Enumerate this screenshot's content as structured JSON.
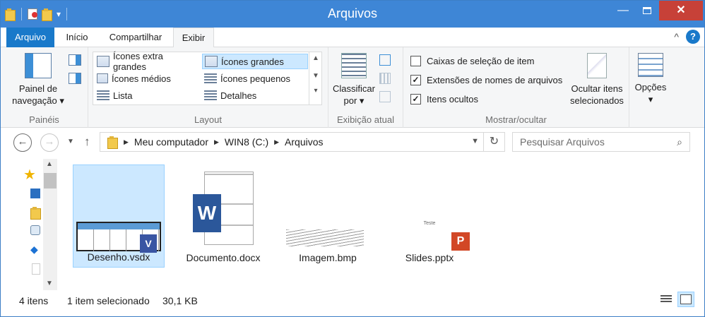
{
  "window": {
    "title": "Arquivos",
    "minimize_label": "—",
    "close_label": "✕"
  },
  "qat": {
    "dropdown_icon": "▾"
  },
  "tabs": [
    {
      "label": "Arquivo"
    },
    {
      "label": "Início"
    },
    {
      "label": "Compartilhar"
    },
    {
      "label": "Exibir"
    }
  ],
  "help_label": "?",
  "collapse_icon": "^",
  "ribbon": {
    "panes": {
      "group_label": "Painéis",
      "nav_pane_line1": "Painel de",
      "nav_pane_line2": "navegação ▾"
    },
    "layout": {
      "group_label": "Layout",
      "options": [
        {
          "label": "Ícones extra grandes"
        },
        {
          "label": "Ícones grandes",
          "selected": true
        },
        {
          "label": "Ícones médios"
        },
        {
          "label": "Ícones pequenos"
        },
        {
          "label": "Lista"
        },
        {
          "label": "Detalhes"
        }
      ]
    },
    "current_view": {
      "group_label": "Exibição atual",
      "sort_line1": "Classificar",
      "sort_line2": "por ▾"
    },
    "show_hide": {
      "group_label": "Mostrar/ocultar",
      "checkboxes": [
        {
          "label": "Caixas de seleção de item",
          "checked": false
        },
        {
          "label": "Extensões de nomes de arquivos",
          "checked": true
        },
        {
          "label": "Itens ocultos",
          "checked": true
        }
      ],
      "hide_selected_line1": "Ocultar itens",
      "hide_selected_line2": "selecionados"
    },
    "options": {
      "label": "Opções",
      "arrow": "▾"
    }
  },
  "address": {
    "crumbs": [
      "Meu computador",
      "WIN8 (C:)",
      "Arquivos"
    ],
    "separator": "▶",
    "search_placeholder": "Pesquisar Arquivos"
  },
  "files": [
    {
      "name": "Desenho.vsdx",
      "selected": true
    },
    {
      "name": "Documento.docx",
      "selected": false
    },
    {
      "name": "Imagem.bmp",
      "selected": false
    },
    {
      "name": "Slides.pptx",
      "selected": false,
      "thumb_text": "Teste"
    }
  ],
  "status": {
    "count": "4 itens",
    "selection": "1 item selecionado",
    "size": "30,1 KB"
  },
  "colors": {
    "accent": "#1979ca",
    "title_bar": "#3e86d6",
    "close": "#c74138",
    "selection": "#cce8ff"
  }
}
